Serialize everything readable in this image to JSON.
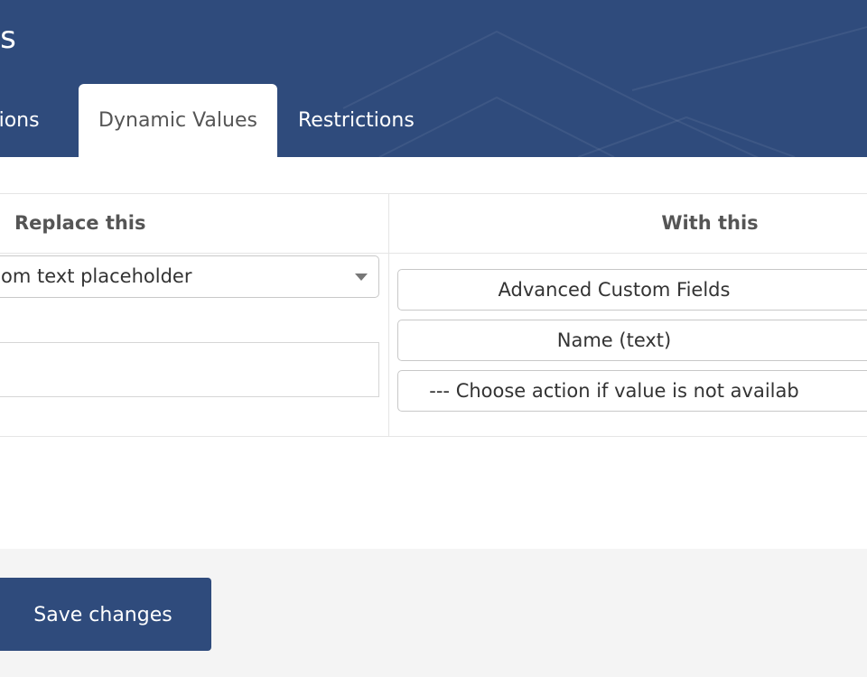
{
  "header": {
    "title": "gs"
  },
  "tabs": [
    {
      "label": "ptions",
      "active": false
    },
    {
      "label": "Dynamic Values",
      "active": true
    },
    {
      "label": "Restrictions",
      "active": false
    }
  ],
  "table": {
    "headers": {
      "replace": "Replace this",
      "with": "With this"
    },
    "replace": {
      "select_value": "om text placeholder",
      "input_value": ""
    },
    "with": {
      "source_select": "Advanced Custom Fields",
      "field_select": "Name (text)",
      "fallback_select": "--- Choose action if value is not availab"
    }
  },
  "footer": {
    "save_label": "Save changes"
  },
  "colors": {
    "brand": "#2f4b7c",
    "panel": "#ffffff",
    "background": "#f4f4f4"
  }
}
